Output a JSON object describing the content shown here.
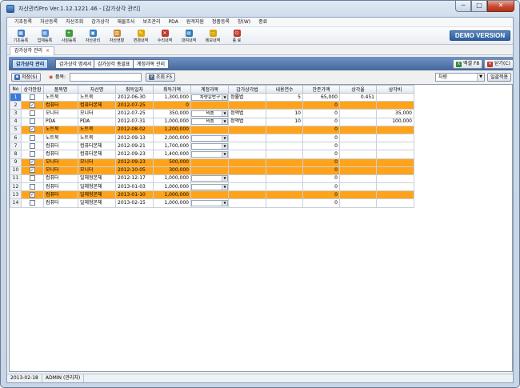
{
  "window": {
    "title": "자산관리Pro Ver.1.12.1221.46 - [감가상각 관리]",
    "buttons": {
      "minimize": "─",
      "maximize": "□",
      "close": "✕"
    }
  },
  "menu": [
    "기초등록",
    "자산등록",
    "자산조회",
    "감가상각",
    "재물조사",
    "보조관리",
    "PDA",
    "원격지원",
    "정품등록",
    "창(W)",
    "종료"
  ],
  "toolbar": [
    {
      "label": "기초등록",
      "icon": "grid-icon",
      "color": "#3a78c8",
      "glyph": "▦"
    },
    {
      "label": "업체등록",
      "icon": "building-icon",
      "color": "#4b8ad0",
      "glyph": "▤"
    },
    {
      "label": "사원등록",
      "icon": "user-add-icon",
      "color": "#3f9a3a",
      "glyph": "+"
    },
    {
      "label": "자산관리",
      "icon": "asset-icon",
      "color": "#2f7ac0",
      "glyph": "▣"
    },
    {
      "label": "자산현황",
      "icon": "chart-icon",
      "color": "#c9872b",
      "glyph": "▥"
    },
    {
      "label": "변경내역",
      "icon": "edit-icon",
      "color": "#e0a800",
      "glyph": "✎"
    },
    {
      "label": "수리내역",
      "icon": "wrench-icon",
      "color": "#c0392b",
      "glyph": "✕"
    },
    {
      "label": "대여내역",
      "icon": "lend-icon",
      "color": "#2b79b8",
      "glyph": "▤"
    },
    {
      "label": "메모내역",
      "icon": "memo-icon",
      "color": "#d9a400",
      "glyph": "▭"
    },
    {
      "label": "종 료",
      "icon": "power-icon",
      "color": "#c0392b",
      "glyph": "⏻"
    }
  ],
  "demo_label": "DEMO VERSION",
  "doc_tab": {
    "label": "감가상각 관리",
    "close": "×"
  },
  "subtabs": [
    "감가상각 관리",
    "감가상각 명세서",
    "감가상각 총괄표",
    "계정과목 관리"
  ],
  "sub_buttons": {
    "excel": "엑셀 F8",
    "close": "닫기(C)"
  },
  "filter": {
    "save_button": "저장(S)",
    "item_label": "품목:",
    "search_button": "조회 F5",
    "category_value": "차량",
    "apply_all_button": "일괄적용"
  },
  "grid": {
    "columns": [
      "No",
      "상각안함",
      "품목명",
      "자산명",
      "취득일자",
      "취득가액",
      "계정과목",
      "감가상각법",
      "내용연수",
      "잔존가액",
      "상각율",
      "상각비"
    ],
    "rows": [
      {
        "no": "1",
        "check": false,
        "item": "노트북",
        "asset": "노트북",
        "date": "2012-06-30",
        "cost": "1,300,000",
        "account": "차량운반구",
        "method": "정률법",
        "life": "5",
        "residual": "65,000",
        "rate": "0.451",
        "dep": "",
        "hl": false,
        "cur": true
      },
      {
        "no": "2",
        "check": true,
        "item": "컴퓨터",
        "asset": "컴퓨터본체",
        "date": "2012-07-25",
        "cost": "0",
        "account": "",
        "method": "",
        "life": "",
        "residual": "0",
        "rate": "",
        "dep": "",
        "hl": true,
        "cur": false
      },
      {
        "no": "3",
        "check": false,
        "item": "모니터",
        "asset": "모니터",
        "date": "2012-07-25",
        "cost": "350,000",
        "account": "비품",
        "method": "정액법",
        "life": "10",
        "residual": "0",
        "rate": "",
        "dep": "35,000",
        "hl": false,
        "cur": false
      },
      {
        "no": "4",
        "check": false,
        "item": "PDA",
        "asset": "PDA",
        "date": "2012-07-31",
        "cost": "1,000,000",
        "account": "비품",
        "method": "정액법",
        "life": "10",
        "residual": "0",
        "rate": "",
        "dep": "100,000",
        "hl": false,
        "cur": false
      },
      {
        "no": "5",
        "check": true,
        "item": "노트북",
        "asset": "노트북",
        "date": "2012-08-02",
        "cost": "1,200,000",
        "account": "",
        "method": "",
        "life": "",
        "residual": "0",
        "rate": "",
        "dep": "",
        "hl": true,
        "cur": false
      },
      {
        "no": "6",
        "check": false,
        "item": "노트북",
        "asset": "노트북",
        "date": "2012-09-13",
        "cost": "2,000,000",
        "account": "",
        "method": "",
        "life": "",
        "residual": "0",
        "rate": "",
        "dep": "",
        "hl": false,
        "cur": false
      },
      {
        "no": "7",
        "check": false,
        "item": "컴퓨터",
        "asset": "컴퓨터본체",
        "date": "2012-09-21",
        "cost": "1,700,000",
        "account": "",
        "method": "",
        "life": "",
        "residual": "0",
        "rate": "",
        "dep": "",
        "hl": false,
        "cur": false
      },
      {
        "no": "8",
        "check": false,
        "item": "컴퓨터",
        "asset": "컴퓨터본체",
        "date": "2012-09-23",
        "cost": "1,400,000",
        "account": "",
        "method": "",
        "life": "",
        "residual": "0",
        "rate": "",
        "dep": "",
        "hl": false,
        "cur": false
      },
      {
        "no": "9",
        "check": true,
        "item": "모니터",
        "asset": "모니터",
        "date": "2012-09-23",
        "cost": "500,000",
        "account": "",
        "method": "",
        "life": "",
        "residual": "0",
        "rate": "",
        "dep": "",
        "hl": true,
        "cur": false
      },
      {
        "no": "10",
        "check": true,
        "item": "모니터",
        "asset": "모니터",
        "date": "2012-10-05",
        "cost": "300,000",
        "account": "",
        "method": "",
        "life": "",
        "residual": "0",
        "rate": "",
        "dep": "",
        "hl": true,
        "cur": false
      },
      {
        "no": "11",
        "check": false,
        "item": "컴퓨터",
        "asset": "일체형본체",
        "date": "2012-12-17",
        "cost": "1,000,000",
        "account": "",
        "method": "",
        "life": "",
        "residual": "0",
        "rate": "",
        "dep": "",
        "hl": false,
        "cur": false
      },
      {
        "no": "12",
        "check": false,
        "item": "컴퓨터",
        "asset": "일체형본체",
        "date": "2013-01-03",
        "cost": "1,000,000",
        "account": "",
        "method": "",
        "life": "",
        "residual": "0",
        "rate": "",
        "dep": "",
        "hl": false,
        "cur": false
      },
      {
        "no": "13",
        "check": true,
        "item": "컴퓨터",
        "asset": "일체형본체",
        "date": "2013-01-10",
        "cost": "1,000,000",
        "account": "",
        "method": "",
        "life": "",
        "residual": "0",
        "rate": "",
        "dep": "",
        "hl": true,
        "cur": false
      },
      {
        "no": "14",
        "check": false,
        "item": "컴퓨터",
        "asset": "일체형본체",
        "date": "2013-02-15",
        "cost": "1,000,000",
        "account": "",
        "method": "",
        "life": "",
        "residual": "0",
        "rate": "",
        "dep": "",
        "hl": false,
        "cur": false
      }
    ]
  },
  "status": {
    "date": "2013-02-18",
    "user": "ADMIN (관리자)"
  }
}
